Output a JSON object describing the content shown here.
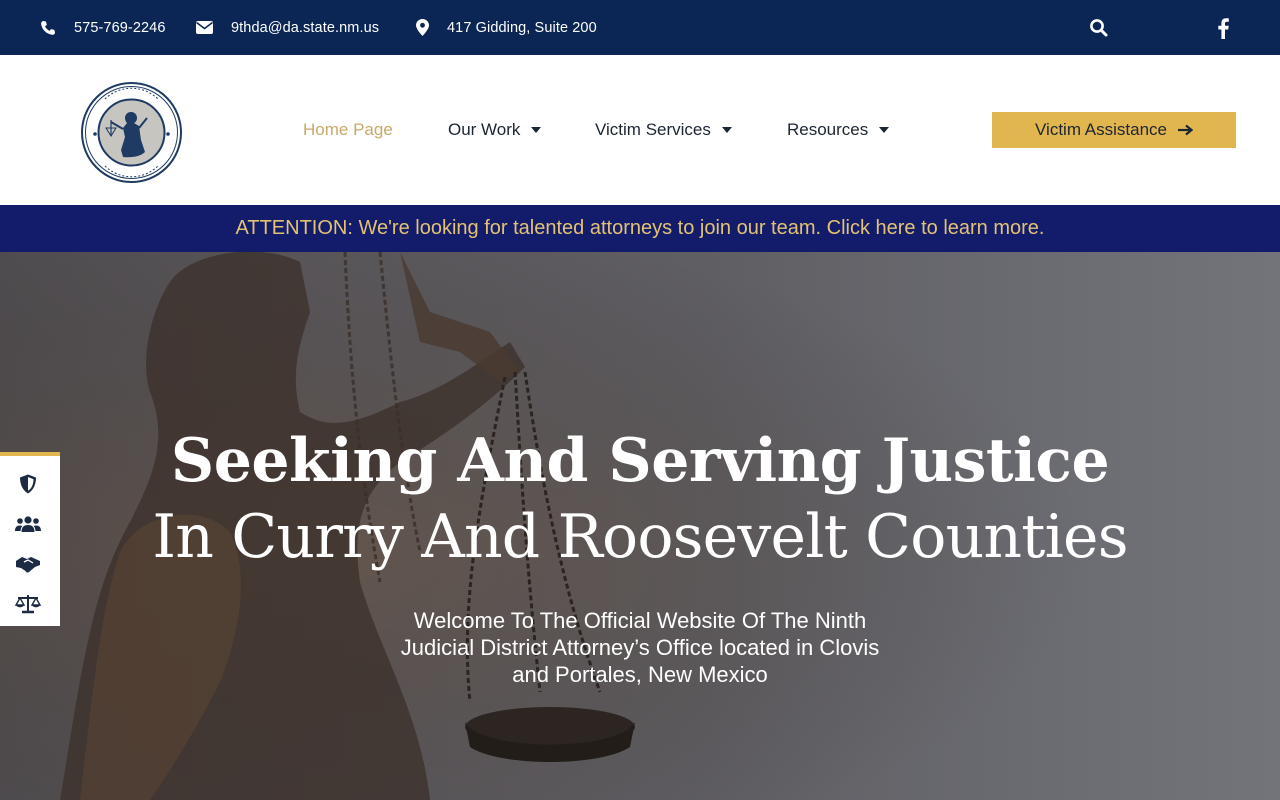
{
  "topbar": {
    "phone": "575-769-2246",
    "email": "9thda@da.state.nm.us",
    "address": "417 Gidding, Suite 200",
    "icons": [
      "phone-icon",
      "envelope-icon",
      "map-pin-icon",
      "search-icon",
      "facebook-icon"
    ]
  },
  "header": {
    "logo": "district-attorney-seal",
    "nav": [
      {
        "label": "Home Page",
        "active": true
      },
      {
        "label": "Our Work",
        "has_dropdown": true
      },
      {
        "label": "Victim Services",
        "has_dropdown": true
      },
      {
        "label": "Resources",
        "has_dropdown": true
      }
    ],
    "cta_label": "Victim Assistance"
  },
  "attention": {
    "text": "ATTENTION: We're looking for talented attorneys to join our team. Click here to learn more."
  },
  "hero": {
    "title_line1": "Seeking And Serving Justice",
    "title_line2": "In Curry And Roosevelt Counties",
    "subtitle": "Welcome To The Official Website Of The Ninth Judicial District Attorney’s Office located in Clovis and Portales, New Mexico"
  },
  "side_widget": {
    "icons": [
      "shield-icon",
      "users-icon",
      "handshake-icon",
      "balance-scale-icon"
    ]
  },
  "colors": {
    "topbar_bg": "#0b2654",
    "attention_bg": "#131b6b",
    "attention_text": "#e3c274",
    "accent_gold": "#e2b64e",
    "nav_active": "#c9a86a"
  }
}
